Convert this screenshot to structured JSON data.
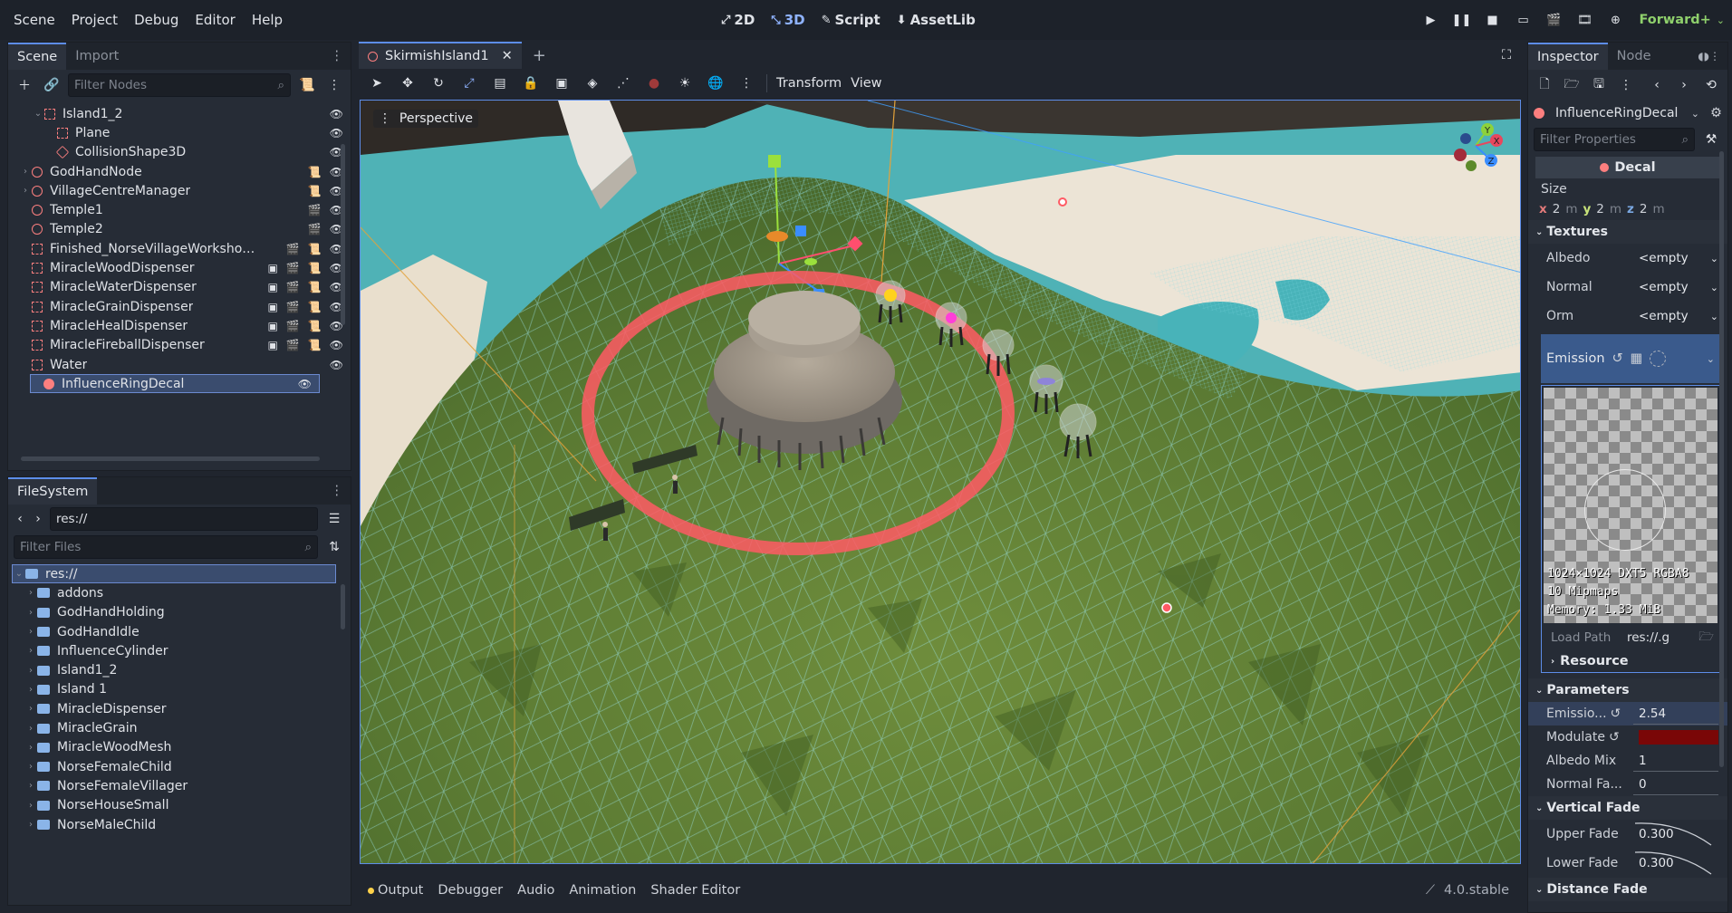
{
  "menu": [
    "Scene",
    "Project",
    "Debug",
    "Editor",
    "Help"
  ],
  "workspaces": [
    {
      "label": "2D",
      "icon": "2d-icon",
      "active": false
    },
    {
      "label": "3D",
      "icon": "3d-icon",
      "active": true
    },
    {
      "label": "Script",
      "icon": "script-icon",
      "active": false
    },
    {
      "label": "AssetLib",
      "icon": "assetlib-icon",
      "active": false
    }
  ],
  "renderer": "Forward+",
  "scene_dock": {
    "tabs": [
      "Scene",
      "Import"
    ],
    "filter_placeholder": "Filter Nodes",
    "nodes": [
      {
        "name": "Island1_2",
        "indent": 1,
        "expand": "open",
        "icon": "mesh",
        "badges": [
          "visible"
        ]
      },
      {
        "name": "Plane",
        "indent": 2,
        "icon": "mesh",
        "badges": [
          "visible"
        ]
      },
      {
        "name": "CollisionShape3D",
        "indent": 2,
        "icon": "hex",
        "badges": [
          "visible"
        ]
      },
      {
        "name": "GodHandNode",
        "indent": 0,
        "expand": "closed",
        "icon": "circ",
        "badges": [
          "script",
          "visible"
        ]
      },
      {
        "name": "VillageCentreManager",
        "indent": 0,
        "expand": "closed",
        "icon": "circ",
        "badges": [
          "script",
          "visible"
        ]
      },
      {
        "name": "Temple1",
        "indent": 0,
        "icon": "circ",
        "badges": [
          "scene",
          "visible"
        ]
      },
      {
        "name": "Temple2",
        "indent": 0,
        "icon": "circ",
        "badges": [
          "scene",
          "visible"
        ]
      },
      {
        "name": "Finished_NorseVillageWorkshopS...",
        "indent": 0,
        "icon": "mesh",
        "badges": [
          "scene",
          "script",
          "visible"
        ]
      },
      {
        "name": "MiracleWoodDispenser",
        "indent": 0,
        "icon": "mesh",
        "badges": [
          "group",
          "scene",
          "script",
          "visible"
        ]
      },
      {
        "name": "MiracleWaterDispenser",
        "indent": 0,
        "icon": "mesh",
        "badges": [
          "group",
          "scene",
          "script",
          "visible"
        ]
      },
      {
        "name": "MiracleGrainDispenser",
        "indent": 0,
        "icon": "mesh",
        "badges": [
          "group",
          "scene",
          "script",
          "visible"
        ]
      },
      {
        "name": "MiracleHealDispenser",
        "indent": 0,
        "icon": "mesh",
        "badges": [
          "group",
          "scene",
          "script",
          "visible"
        ]
      },
      {
        "name": "MiracleFireballDispenser",
        "indent": 0,
        "icon": "mesh",
        "badges": [
          "group",
          "scene",
          "script",
          "visible"
        ]
      },
      {
        "name": "Water",
        "indent": 0,
        "icon": "mesh",
        "badges": [
          "visible"
        ]
      },
      {
        "name": "InfluenceRingDecal",
        "indent": 0,
        "icon": "decal",
        "badges": [
          "visible"
        ],
        "selected": true
      }
    ]
  },
  "filesystem": {
    "tab": "FileSystem",
    "path": "res://",
    "filter_placeholder": "Filter Files",
    "root": "res://",
    "folders": [
      "addons",
      "GodHandHolding",
      "GodHandIdle",
      "InfluenceCylinder",
      "Island1_2",
      "Island 1",
      "MiracleDispenser",
      "MiracleGrain",
      "MiracleWoodMesh",
      "NorseFemaleChild",
      "NorseFemaleVillager",
      "NorseHouseSmall",
      "NorseMaleChild"
    ]
  },
  "editor": {
    "scene_tab": "SkirmishIsland1",
    "toolbar_menus": [
      "Transform",
      "View"
    ],
    "viewport_label": "Perspective",
    "gizmo_axes": [
      "Y",
      "X",
      "Z"
    ]
  },
  "bottom_tabs": [
    "Output",
    "Debugger",
    "Audio",
    "Animation",
    "Shader Editor"
  ],
  "version": "4.0.stable",
  "inspector": {
    "tabs": [
      "Inspector",
      "Node"
    ],
    "object_name": "InfluenceRingDecal",
    "filter_placeholder": "Filter Properties",
    "class_header": "Decal",
    "size_label": "Size",
    "size": {
      "x": "2",
      "y": "2",
      "z": "2",
      "unit": "m"
    },
    "textures_section": "Textures",
    "textures": [
      {
        "label": "Albedo",
        "value": "<empty"
      },
      {
        "label": "Normal",
        "value": "<empty"
      },
      {
        "label": "Orm",
        "value": "<empty"
      }
    ],
    "emission_label": "Emission",
    "texture_info": [
      "1024×1024 DXT5 RGBA8",
      "10 Mipmaps",
      "Memory: 1.33 MiB"
    ],
    "load_path_label": "Load Path",
    "load_path_value": "res://.g",
    "resource_section": "Resource",
    "parameters_section": "Parameters",
    "parameters": [
      {
        "label": "Emissio...",
        "value": "2.54"
      },
      {
        "label": "Modulate",
        "value": ""
      },
      {
        "label": "Albedo Mix",
        "value": "1"
      },
      {
        "label": "Normal Fa...",
        "value": "0"
      }
    ],
    "modulate_color": "#7a0707",
    "vertical_fade_section": "Vertical Fade",
    "fades": [
      {
        "label": "Upper Fade",
        "value": "0.300"
      },
      {
        "label": "Lower Fade",
        "value": "0.300"
      }
    ],
    "distance_fade_section": "Distance Fade"
  },
  "colors": {
    "accent": "#5d8de8",
    "node_red": "#fc7f7f",
    "renderer_green": "#8fd06c"
  }
}
